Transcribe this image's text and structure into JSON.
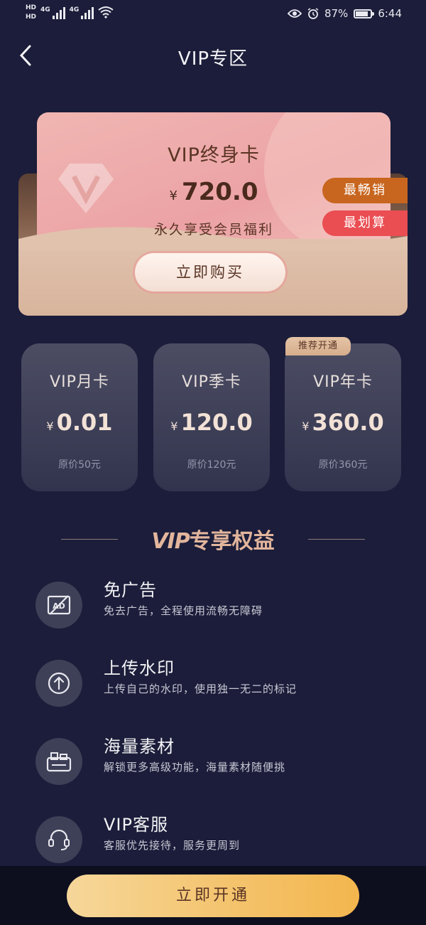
{
  "status_bar": {
    "hd1": "HD",
    "hd2": "HD",
    "sig1_label": "4G",
    "sig2_label": "4G",
    "battery_text": "87%",
    "time": "6:44"
  },
  "nav": {
    "title": "VIP专区"
  },
  "hero": {
    "title": "VIP终身卡",
    "currency": "¥",
    "price": "720.0",
    "subtitle": "永久享受会员福利",
    "tag_best": "最畅销",
    "tag_value": "最划算",
    "buy_label": "立即购买"
  },
  "plans": [
    {
      "name": "VIP月卡",
      "currency": "¥",
      "price": "0.01",
      "original": "原价50元"
    },
    {
      "name": "VIP季卡",
      "currency": "¥",
      "price": "120.0",
      "original": "原价120元"
    },
    {
      "name": "VIP年卡",
      "currency": "¥",
      "price": "360.0",
      "original": "原价360元"
    }
  ],
  "recommend_badge": "推荐开通",
  "section": {
    "vip": "VIP",
    "title": "专享权益"
  },
  "benefits": [
    {
      "title": "免广告",
      "desc": "免去广告，全程使用流畅无障碍",
      "icon": "no-ads-icon"
    },
    {
      "title": "上传水印",
      "desc": "上传自己的水印，使用独一无二的标记",
      "icon": "upload-icon"
    },
    {
      "title": "海量素材",
      "desc": "解锁更多高级功能，海量素材随便挑",
      "icon": "materials-icon"
    },
    {
      "title": "VIP客服",
      "desc": "客服优先接待，服务更周到",
      "icon": "headset-icon"
    }
  ],
  "bottom": {
    "open_label": "立即开通"
  },
  "colors": {
    "background": "#1b1d3a",
    "accent_gold": "#e2b59c",
    "button_gold": "#f4c26a",
    "tag_orange": "#c8661f",
    "tag_red": "#ea4d52"
  }
}
